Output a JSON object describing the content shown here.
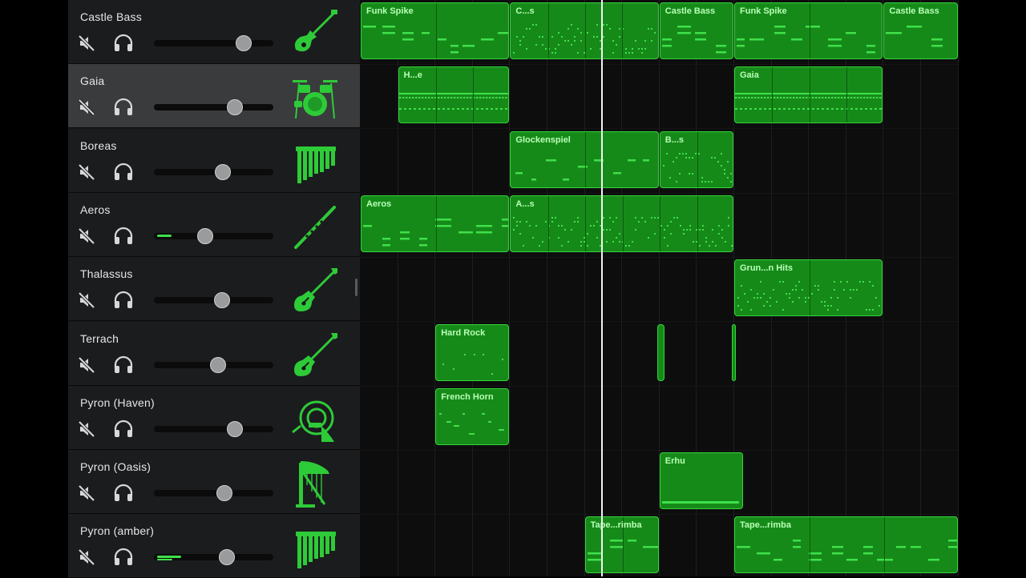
{
  "tracks": [
    {
      "name": "Castle Bass",
      "volume": 0.75,
      "level": 0,
      "instrument": "bass-guitar-icon",
      "selected": false
    },
    {
      "name": "Gaia",
      "volume": 0.68,
      "level": 0,
      "instrument": "drum-kit-icon",
      "selected": true
    },
    {
      "name": "Boreas",
      "volume": 0.58,
      "level": 0,
      "instrument": "pan-flute-icon",
      "selected": false
    },
    {
      "name": "Aeros",
      "volume": 0.43,
      "level": 0.12,
      "instrument": "recorder-icon",
      "selected": false
    },
    {
      "name": "Thalassus",
      "volume": 0.57,
      "level": 0,
      "instrument": "electric-guitar-icon",
      "selected": false
    },
    {
      "name": "Terrach",
      "volume": 0.54,
      "level": 0,
      "instrument": "electric-guitar-icon",
      "selected": false
    },
    {
      "name": "Pyron (Haven)",
      "volume": 0.68,
      "level": 0,
      "instrument": "french-horn-icon",
      "selected": false
    },
    {
      "name": "Pyron (Oasis)",
      "volume": 0.59,
      "level": 0,
      "instrument": "harp-icon",
      "selected": false
    },
    {
      "name": "Pyron (amber)",
      "volume": 0.61,
      "level": 0.2,
      "instrument": "pan-flute-icon",
      "selected": false
    }
  ],
  "regions": [
    {
      "track": 0,
      "label": "Funk Spike",
      "start": 0,
      "end": 4,
      "loops": 2,
      "pattern": "bass"
    },
    {
      "track": 0,
      "label": "C...s",
      "start": 4,
      "end": 8,
      "loops": 4,
      "pattern": "dots"
    },
    {
      "track": 0,
      "label": "Castle Bass",
      "start": 8,
      "end": 10,
      "loops": 1,
      "pattern": "bass"
    },
    {
      "track": 0,
      "label": "Funk Spike",
      "start": 10,
      "end": 14,
      "loops": 2,
      "pattern": "bass"
    },
    {
      "track": 0,
      "label": "Castle Bass",
      "start": 14,
      "end": 16,
      "loops": 1,
      "pattern": "bass"
    },
    {
      "track": 1,
      "label": "H...e",
      "start": 1,
      "end": 4,
      "loops": 3,
      "pattern": "drums"
    },
    {
      "track": 1,
      "label": "Gaia",
      "start": 10,
      "end": 14,
      "loops": 4,
      "pattern": "drums"
    },
    {
      "track": 2,
      "label": "Glockenspiel",
      "start": 4,
      "end": 8,
      "loops": 2,
      "pattern": "glock"
    },
    {
      "track": 2,
      "label": "B...s",
      "start": 8,
      "end": 10,
      "loops": 2,
      "pattern": "dots"
    },
    {
      "track": 3,
      "label": "Aeros",
      "start": 0,
      "end": 4,
      "loops": 2,
      "pattern": "bass"
    },
    {
      "track": 3,
      "label": "A...s",
      "start": 4,
      "end": 10,
      "loops": 6,
      "pattern": "dots"
    },
    {
      "track": 4,
      "label": "Grun...n Hits",
      "start": 10,
      "end": 14,
      "loops": 2,
      "pattern": "dots"
    },
    {
      "track": 5,
      "label": "Hard Rock",
      "start": 2,
      "end": 4,
      "loops": 1,
      "pattern": "sparse"
    },
    {
      "track": 5,
      "label": "",
      "start": 7.93,
      "end": 8.15,
      "loops": 1,
      "pattern": "none"
    },
    {
      "track": 5,
      "label": "",
      "start": 9.93,
      "end": 10.07,
      "loops": 1,
      "pattern": "none"
    },
    {
      "track": 6,
      "label": "French Horn",
      "start": 2,
      "end": 4,
      "loops": 1,
      "pattern": "horn"
    },
    {
      "track": 7,
      "label": "Erhu",
      "start": 8,
      "end": 10.25,
      "loops": 1,
      "pattern": "long"
    },
    {
      "track": 8,
      "label": "Tape...rimba",
      "start": 6,
      "end": 8,
      "loops": 2,
      "pattern": "bass"
    },
    {
      "track": 8,
      "label": "Tape...rimba",
      "start": 10,
      "end": 16,
      "loops": 3,
      "pattern": "bass"
    }
  ],
  "colors": {
    "region": "#168a19",
    "region_border": "#36d33c",
    "note": "#3fe04a",
    "label": "#b8ffb6",
    "selected_header": "#3a3b3d",
    "playhead": "#f2f2f2"
  },
  "icons": {
    "mute": "speaker-muted-icon",
    "solo": "headphones-icon"
  }
}
